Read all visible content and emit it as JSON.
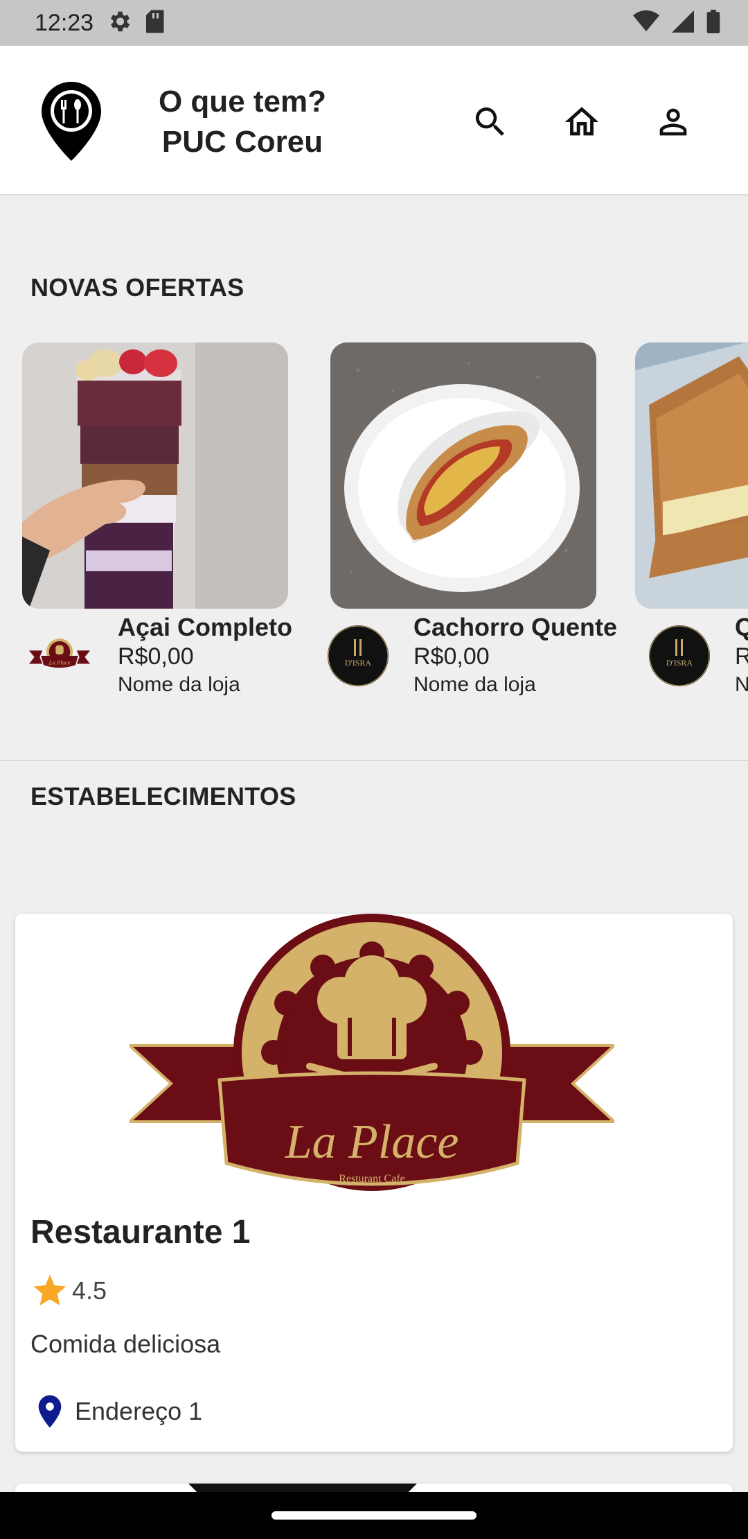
{
  "status_bar": {
    "time": "12:23"
  },
  "app_bar": {
    "title": "O que tem?\nPUC Coreu"
  },
  "sections": {
    "offers": "NOVAS OFERTAS",
    "establishments": "ESTABELECIMENTOS"
  },
  "offers": [
    {
      "name": "Açai Completo",
      "price": "R$0,00",
      "store": "Nome da loja"
    },
    {
      "name": "Cachorro Quente",
      "price": "R$0,00",
      "store": "Nome da loja"
    },
    {
      "name": "Q",
      "price": "R",
      "store": "N"
    }
  ],
  "logos": {
    "laplace_text": "La Place",
    "laplace_sub": "Resturant Cafe",
    "disra_text": "D'ISRA"
  },
  "establishment": {
    "name": "Restaurante 1",
    "rating": "4.5",
    "description": "Comida deliciosa",
    "address": "Endereço 1"
  },
  "colors": {
    "brand_maroon": "#6b0d14",
    "brand_gold": "#d4b26a",
    "star": "#f9a825",
    "pin": "#0d1b8c"
  }
}
